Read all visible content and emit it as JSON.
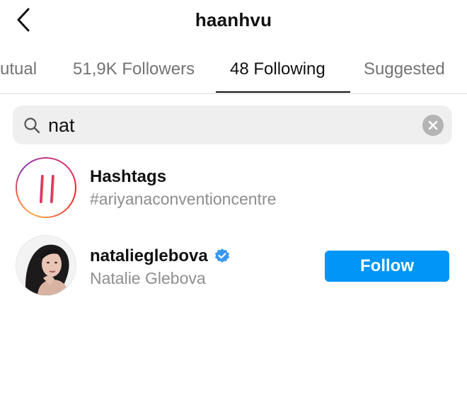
{
  "header": {
    "title": "haanhvu"
  },
  "tabs": [
    {
      "label": "Mutual",
      "active": false
    },
    {
      "label": "51,9K Followers",
      "active": false
    },
    {
      "label": "48 Following",
      "active": true
    },
    {
      "label": "Suggested",
      "active": false
    }
  ],
  "search": {
    "value": "nat",
    "placeholder": "Search"
  },
  "results": [
    {
      "title": "Hashtags",
      "subtitle": "#ariyanaconventioncentre",
      "icon": "hashtag-icon"
    },
    {
      "title": "natalieglebova",
      "subtitle": "Natalie Glebova",
      "verified": true,
      "button_label": "Follow",
      "icon": "verified-badge-icon"
    }
  ],
  "colors": {
    "accent": "#0095f6",
    "verified": "#3897f0",
    "muted_text": "#8e8e8e"
  }
}
